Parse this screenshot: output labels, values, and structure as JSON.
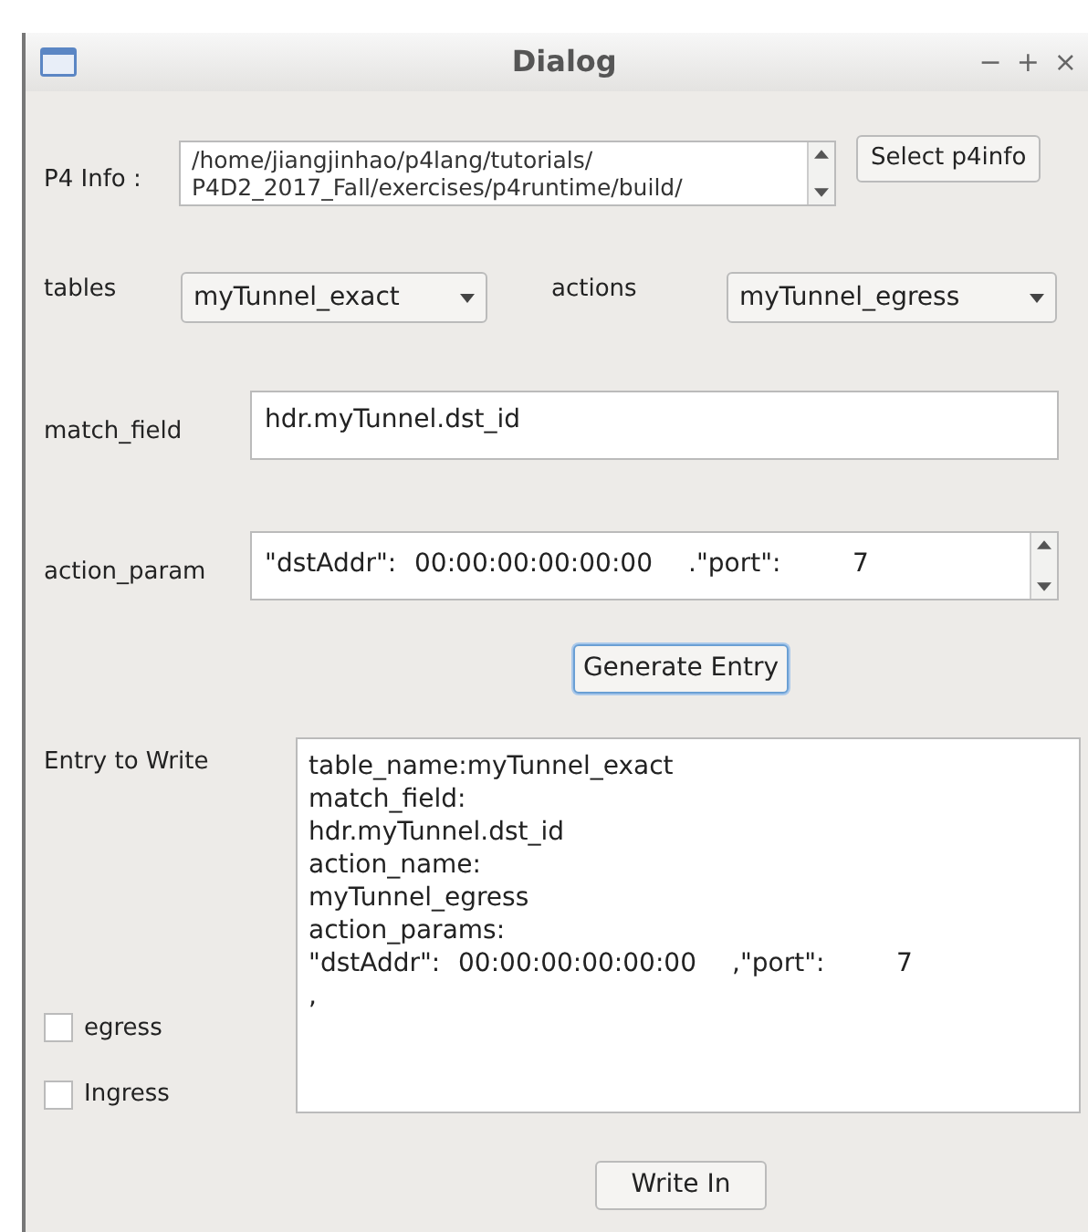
{
  "window": {
    "title": "Dialog",
    "controls": [
      "−",
      "+",
      "×"
    ]
  },
  "p4info": {
    "label": "P4 Info :",
    "lines": [
      "/home/jiangjinhao/p4lang/tutorials/",
      "P4D2_2017_Fall/exercises/p4runtime/build/"
    ],
    "button": "Select p4info"
  },
  "tables": {
    "label": "tables",
    "value": "myTunnel_exact"
  },
  "actions": {
    "label": "actions",
    "value": "myTunnel_egress"
  },
  "match_field": {
    "label": "match_field",
    "value": "hdr.myTunnel.dst_id"
  },
  "action_param": {
    "label": "action_param",
    "segments": [
      "\"dstAddr\":",
      "00:00:00:00:00:00",
      ".\"port\":",
      "7"
    ]
  },
  "generate_button": {
    "label": "Generate Entry",
    "focused": true
  },
  "entry": {
    "label": "Entry to Write",
    "lines": [
      {
        "kind": "text",
        "text": "table_name:myTunnel_exact"
      },
      {
        "kind": "text",
        "text": "match_field:"
      },
      {
        "kind": "text",
        "text": "hdr.myTunnel.dst_id"
      },
      {
        "kind": "text",
        "text": "action_name:"
      },
      {
        "kind": "text",
        "text": "myTunnel_egress"
      },
      {
        "kind": "text",
        "text": "action_params:"
      },
      {
        "kind": "params",
        "segments": [
          "\"dstAddr\":",
          "00:00:00:00:00:00",
          ",\"port\":",
          "7"
        ]
      },
      {
        "kind": "text",
        "text": ","
      }
    ]
  },
  "checkboxes": [
    {
      "label": "egress",
      "checked": false
    },
    {
      "label": "Ingress",
      "checked": false
    }
  ],
  "write_button": {
    "label": "Write In"
  }
}
